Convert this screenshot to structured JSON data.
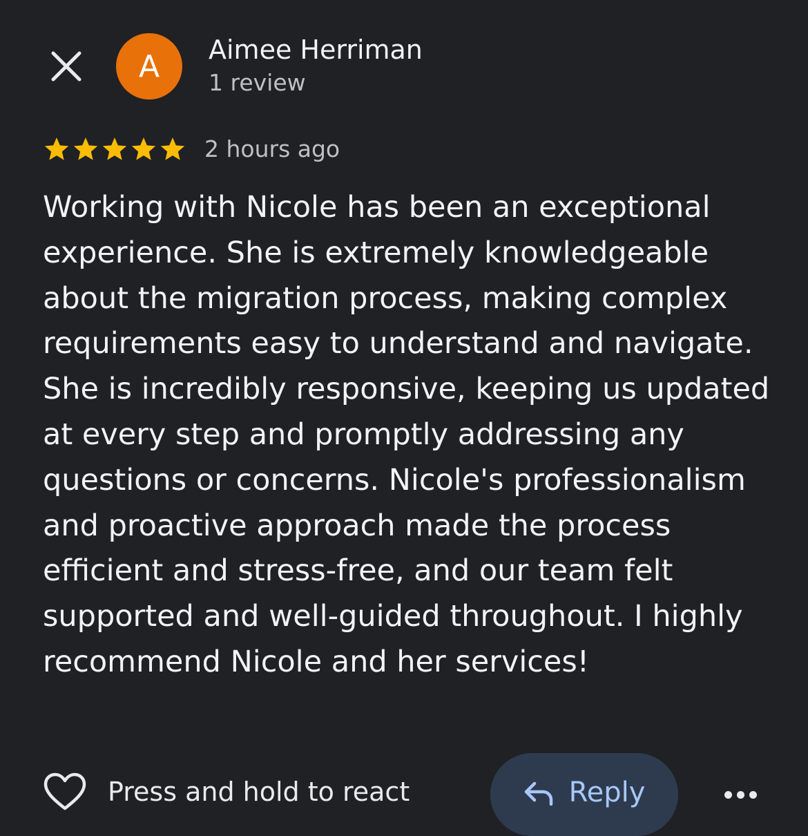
{
  "review": {
    "author_name": "Aimee Herriman",
    "author_initial": "A",
    "author_review_count": "1 review",
    "avatar_color": "#E8710A",
    "rating": 5,
    "rating_max": 5,
    "star_color": "#FBBC04",
    "time_ago": "2 hours ago",
    "text": "Working with Nicole has been an exceptional experience. She is extremely knowledgeable about the migration process, making complex requirements easy to understand and navigate. She is incredibly responsive, keeping us updated at every step and promptly addressing any questions or concerns. Nicole's professionalism and proactive approach made the process efficient and stress-free, and our team felt supported and well-guided throughout. I highly recommend Nicole and her services!"
  },
  "actions": {
    "react_label": "Press and hold to react",
    "reply_label": "Reply",
    "reply_accent": "#A8C7FA"
  },
  "icons": {
    "close": "close-icon",
    "heart": "heart-outline-icon",
    "reply": "reply-arrow-icon",
    "more": "more-horizontal-icon",
    "star": "star-icon"
  }
}
